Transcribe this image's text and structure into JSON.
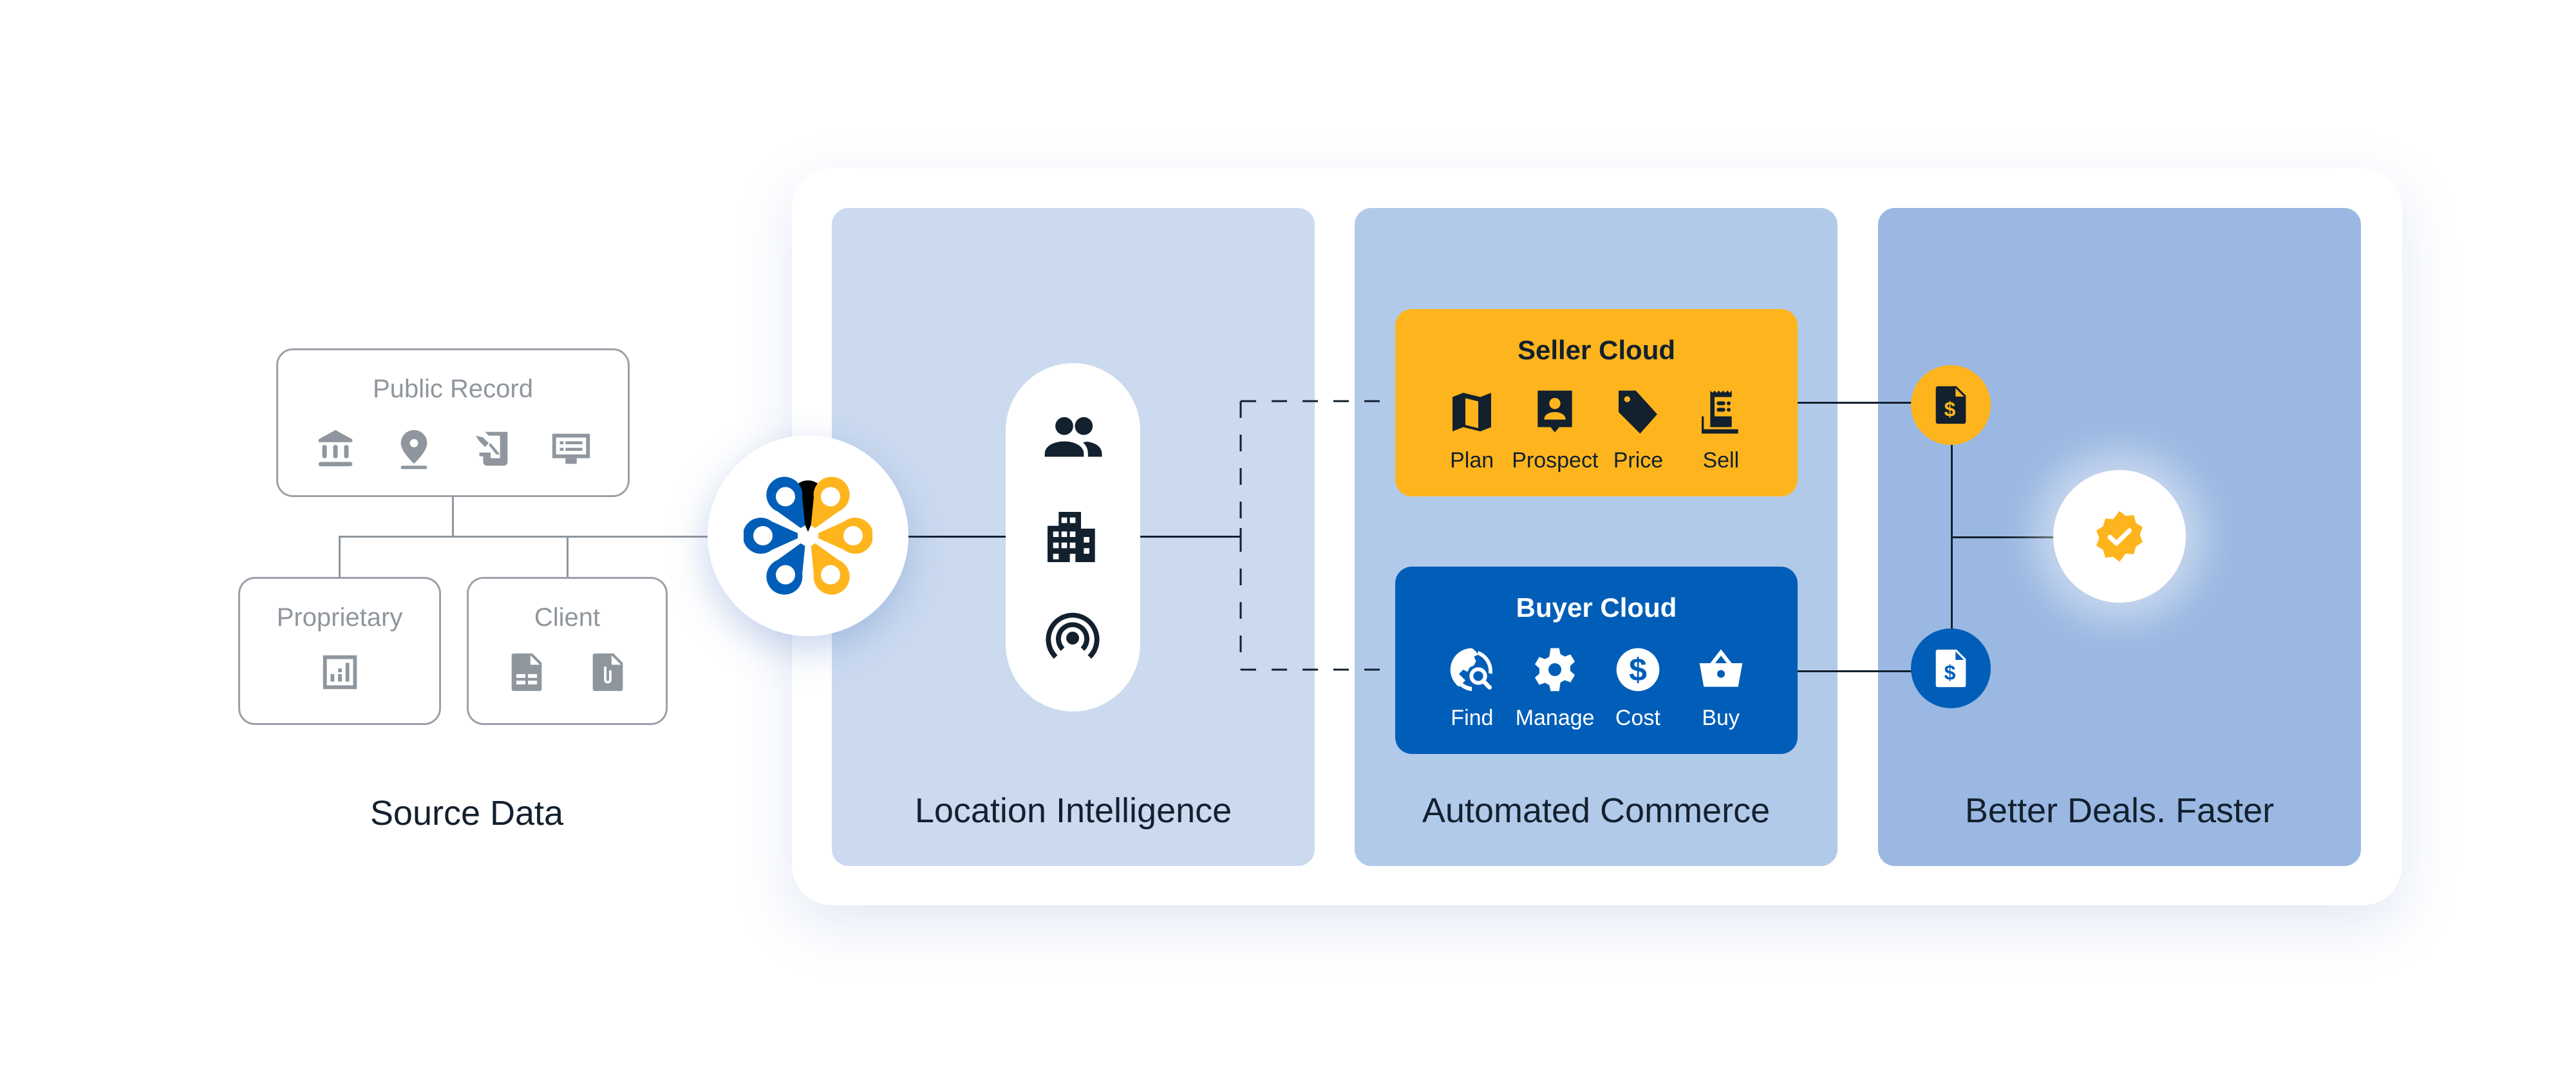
{
  "source_data": {
    "label": "Source Data",
    "boxes": {
      "public_record": {
        "title": "Public Record",
        "icons": [
          "bank-icon",
          "location-pin-icon",
          "deed-icon",
          "monitor-list-icon"
        ]
      },
      "proprietary": {
        "title": "Proprietary",
        "icons": [
          "analytics-report-icon"
        ]
      },
      "client": {
        "title": "Client",
        "icons": [
          "spreadsheet-file-icon",
          "attachment-file-icon"
        ]
      }
    }
  },
  "logo": {
    "name": "flower-pins-logo",
    "colors": {
      "blue": "#005eb8",
      "yellow": "#feb51d"
    }
  },
  "panels": [
    {
      "label": "Location Intelligence",
      "color": "#cbdaef",
      "icons": [
        "people-icon",
        "buildings-icon",
        "signal-tower-icon"
      ]
    },
    {
      "label": "Automated Commerce",
      "color": "#b2caea"
    },
    {
      "label": "Better Deals. Faster",
      "color": "#9ab8e2"
    }
  ],
  "seller_cloud": {
    "title": "Seller Cloud",
    "color": "#feb51d",
    "items": [
      {
        "label": "Plan",
        "icon": "map-icon"
      },
      {
        "label": "Prospect",
        "icon": "contact-pin-icon"
      },
      {
        "label": "Price",
        "icon": "price-tag-icon"
      },
      {
        "label": "Sell",
        "icon": "receipt-icon"
      }
    ]
  },
  "buyer_cloud": {
    "title": "Buyer Cloud",
    "color": "#005eb8",
    "items": [
      {
        "label": "Find",
        "icon": "globe-search-icon"
      },
      {
        "label": "Manage",
        "icon": "gear-icon"
      },
      {
        "label": "Cost",
        "icon": "dollar-circle-icon"
      },
      {
        "label": "Buy",
        "icon": "shopping-basket-icon"
      }
    ]
  },
  "outcomes": {
    "seller_node_icon": "invoice-dollar-icon",
    "buyer_node_icon": "invoice-dollar-icon",
    "result_icon": "verified-badge-icon"
  }
}
